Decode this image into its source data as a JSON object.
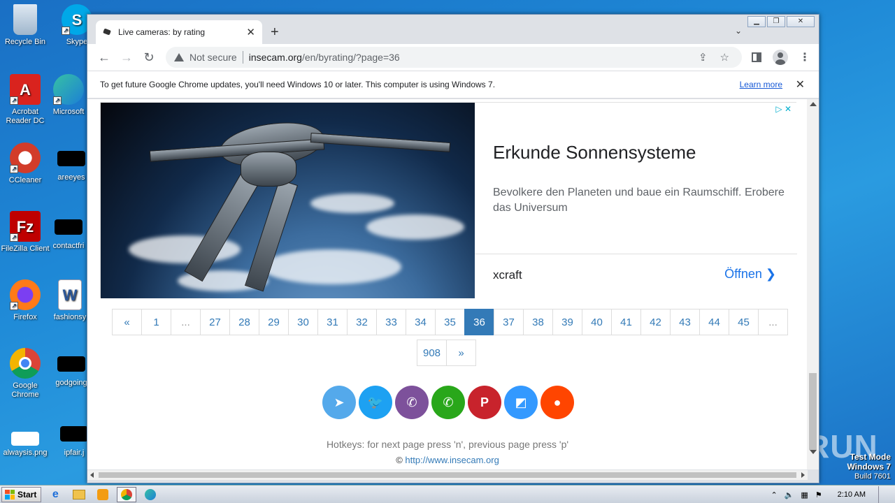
{
  "desktop": {
    "icons": [
      {
        "label": "Recycle Bin"
      },
      {
        "label": "Skype"
      },
      {
        "label": "Acrobat Reader DC"
      },
      {
        "label": "Microsoft"
      },
      {
        "label": "CCleaner"
      },
      {
        "label": "areeyes"
      },
      {
        "label": "FileZilla Client"
      },
      {
        "label": "contactfri"
      },
      {
        "label": "Firefox"
      },
      {
        "label": "fashionsy"
      },
      {
        "label": "Google Chrome"
      },
      {
        "label": "godgoing"
      },
      {
        "label": "alwaysis.png"
      },
      {
        "label": "ipfair.j"
      }
    ]
  },
  "browser": {
    "tab": {
      "title": "Live cameras: by rating",
      "close": "✕"
    },
    "new_tab": "+",
    "address": {
      "security": "Not secure",
      "host": "insecam.org",
      "path": "/en/byrating/?page=36"
    },
    "infobar": {
      "message": "To get future Google Chrome updates, you'll need Windows 10 or later. This computer is using Windows 7.",
      "link": "Learn more"
    }
  },
  "ad": {
    "headline": "Erkunde Sonnensysteme",
    "description": "Bevolkere den Planeten und baue ein Raumschiff. Erobere das Universum",
    "advertiser": "xcraft",
    "cta": "Öffnen"
  },
  "pagination": {
    "row1": [
      "«",
      "1",
      "...",
      "27",
      "28",
      "29",
      "30",
      "31",
      "32",
      "33",
      "34",
      "35",
      "36",
      "37",
      "38",
      "39",
      "40",
      "41",
      "42",
      "43",
      "44",
      "45",
      "..."
    ],
    "row2": [
      "908",
      "»"
    ],
    "active": "36"
  },
  "share": [
    {
      "name": "telegram",
      "color": "#54a9eb"
    },
    {
      "name": "twitter",
      "color": "#1da1f2"
    },
    {
      "name": "viber",
      "color": "#7d519b"
    },
    {
      "name": "whatsapp",
      "color": "#29a71a"
    },
    {
      "name": "pinterest",
      "color": "#c8232c"
    },
    {
      "name": "delicious",
      "color": "#3399ff"
    },
    {
      "name": "reddit",
      "color": "#ff4500"
    }
  ],
  "footer": {
    "hotkeys": "Hotkeys: for next page press 'n', previous page press 'p'",
    "copyright_symbol": "©",
    "link": "http://www.insecam.org"
  },
  "watermark": {
    "brand": "ANY RUN",
    "mode": "Test Mode",
    "os": "Windows 7",
    "build": "Build 7601"
  },
  "taskbar": {
    "start": "Start",
    "clock": "2:10 AM"
  }
}
